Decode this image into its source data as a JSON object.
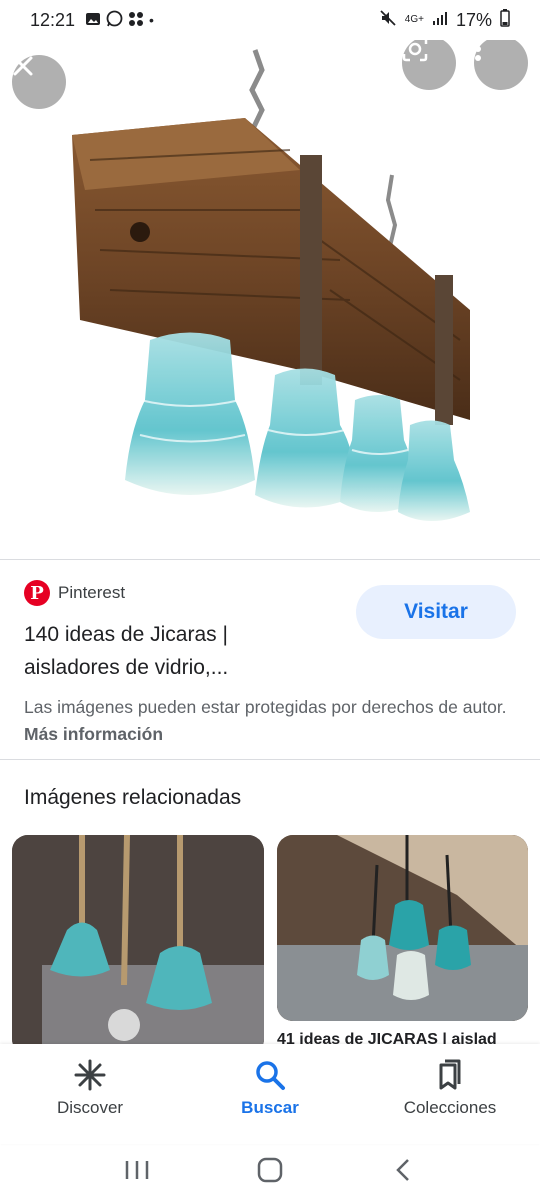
{
  "status_bar": {
    "time": "12:21",
    "dot": "•",
    "network": "4G+",
    "battery": "17%",
    "icons": [
      "gallery-icon",
      "whatsapp-icon",
      "app-grid-icon",
      "mute-icon",
      "signal-icon",
      "battery-icon"
    ]
  },
  "viewer": {
    "close_icon": "close-icon",
    "lens_icon": "lens-icon",
    "more_icon": "more-vert-icon"
  },
  "result": {
    "source_name": "Pinterest",
    "source_logo_letter": "P",
    "visit_label": "Visitar",
    "title_line1": "140 ideas de Jicaras |",
    "title_line2": "aisladores de vidrio,...",
    "copyright_text": "Las imágenes pueden estar protegidas por derechos de autor.",
    "more_info_label": "Más información"
  },
  "related": {
    "heading": "Imágenes relacionadas",
    "items": [
      {
        "caption": ""
      },
      {
        "caption": "41 ideas de JICARAS | aislad"
      }
    ]
  },
  "bottom_nav": {
    "items": [
      {
        "label": "Discover",
        "icon": "asterisk-icon",
        "active": false
      },
      {
        "label": "Buscar",
        "icon": "search-icon",
        "active": true
      },
      {
        "label": "Colecciones",
        "icon": "bookmark-icon",
        "active": false
      }
    ]
  },
  "colors": {
    "accent": "#1a73e8",
    "visit_bg": "#e8f0fe",
    "pinterest": "#e60023"
  }
}
